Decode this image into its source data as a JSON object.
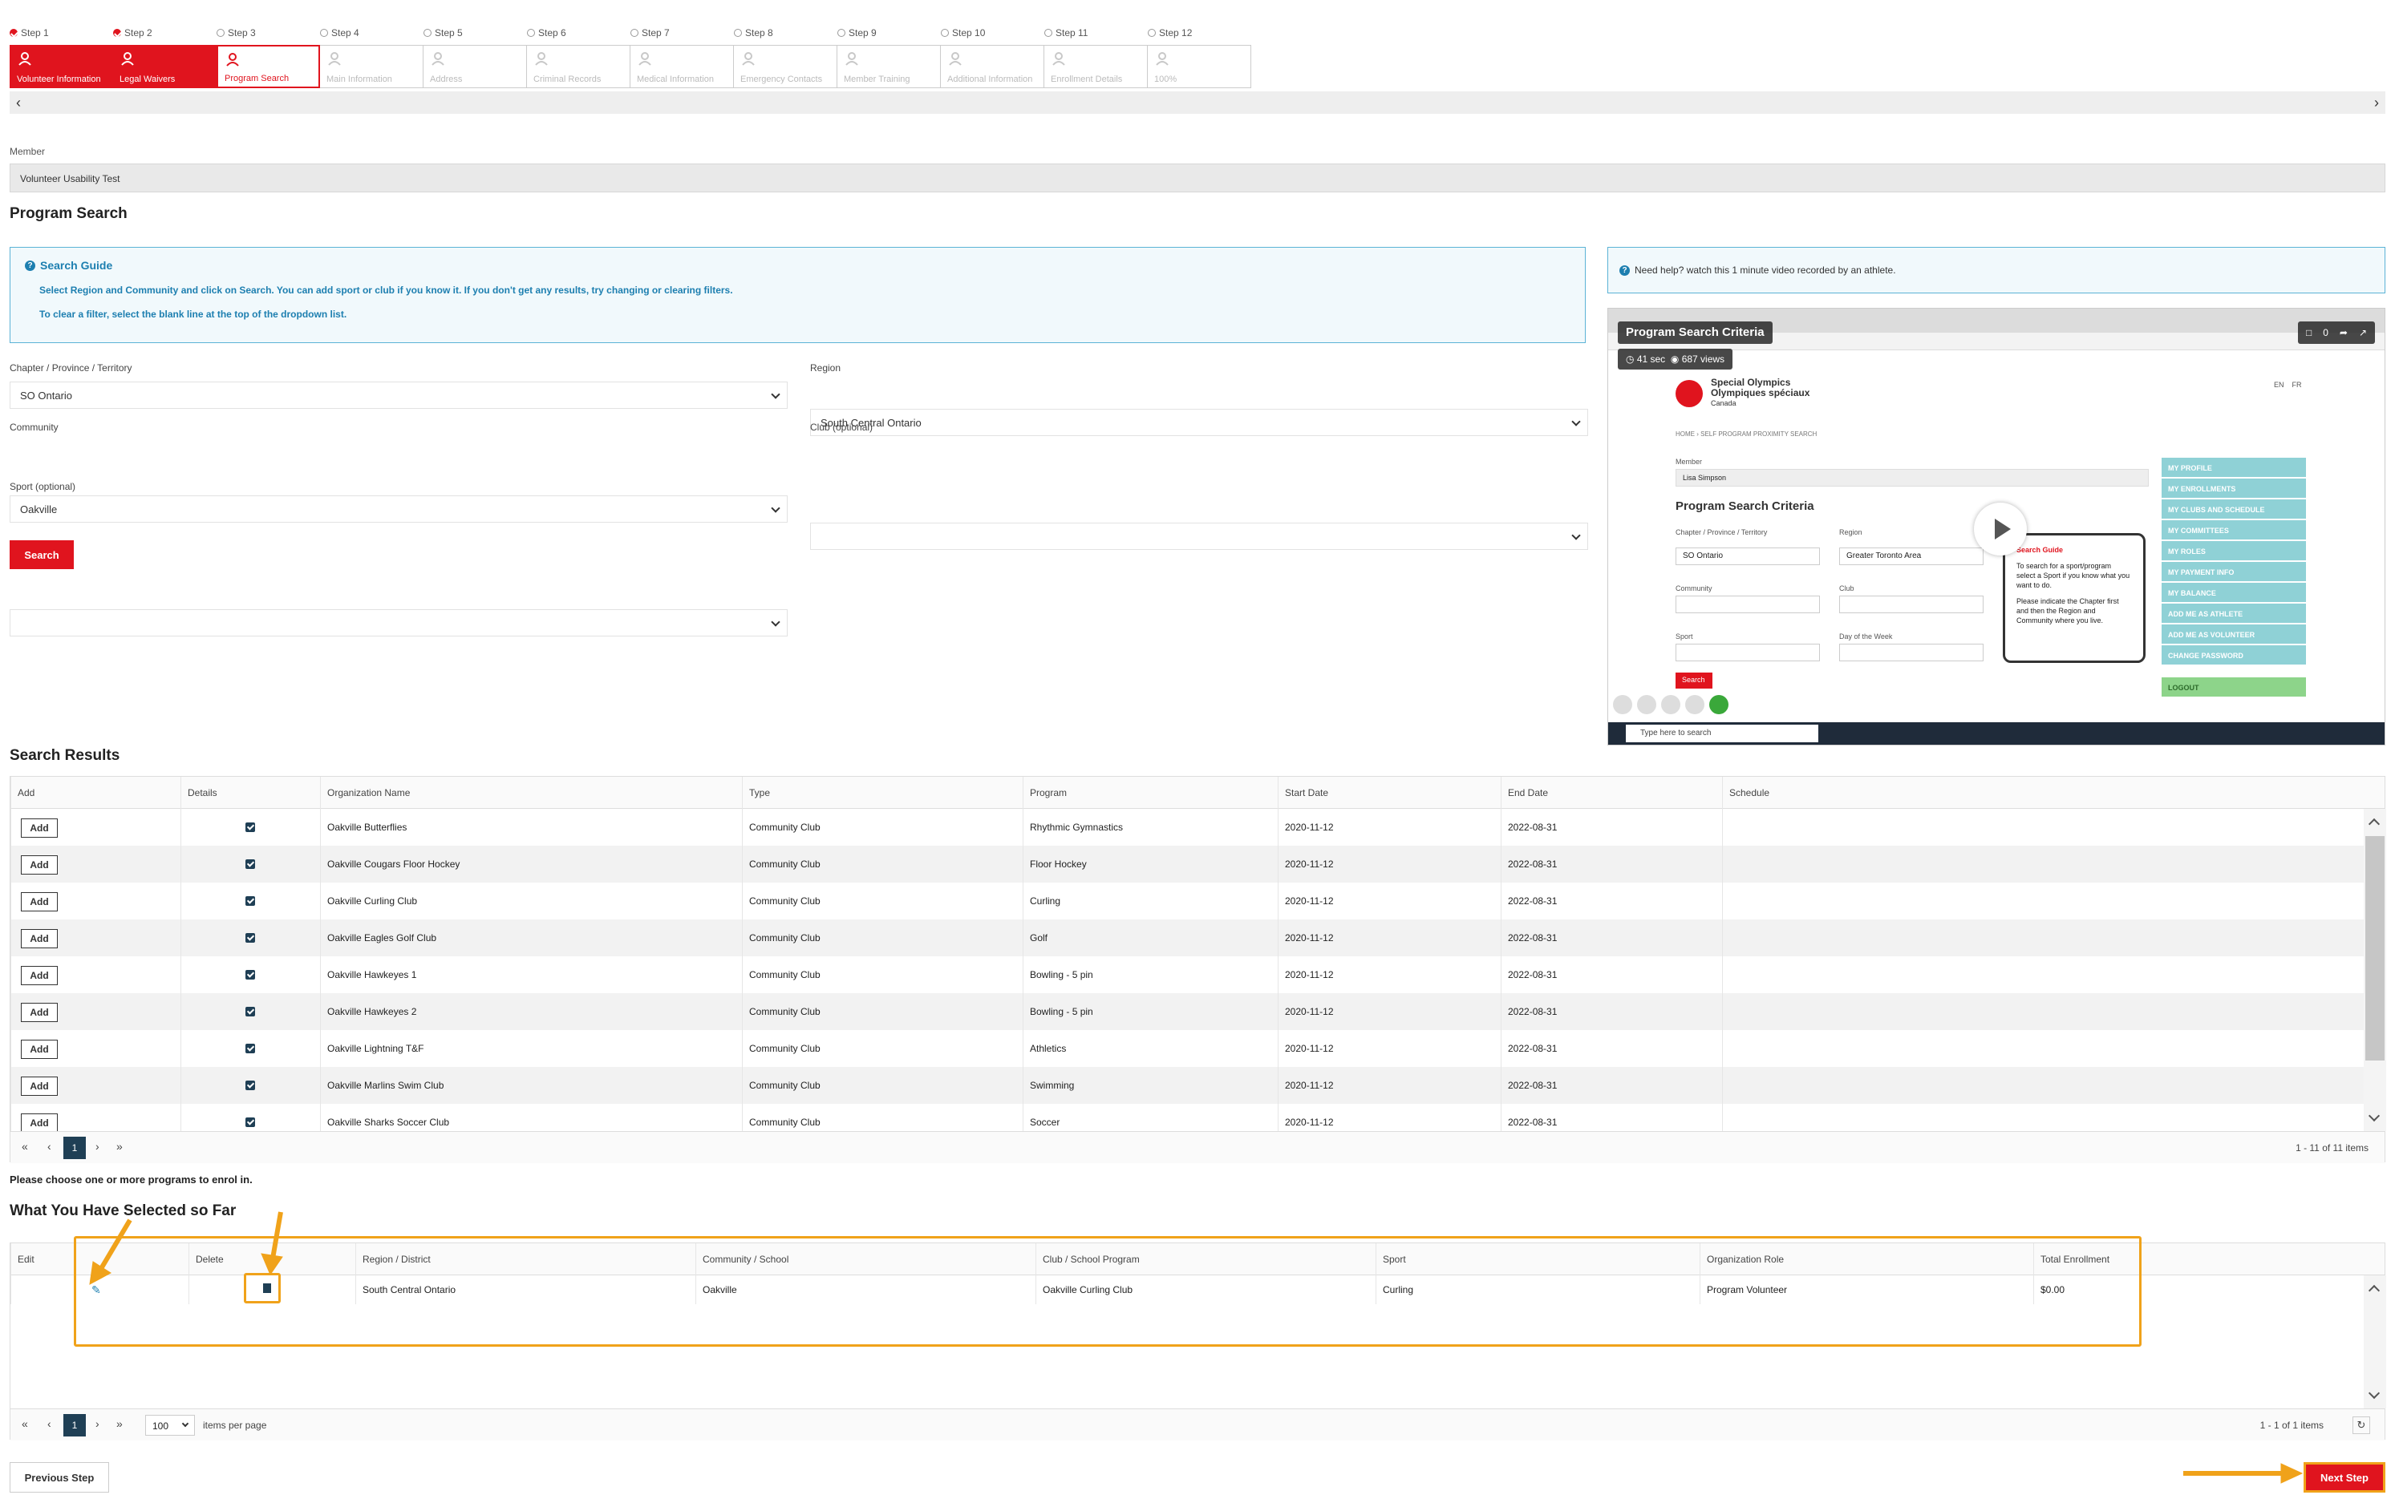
{
  "wizard": {
    "steps": [
      {
        "label": "Step 1",
        "name": "Volunteer Information",
        "state": "done"
      },
      {
        "label": "Step 2",
        "name": "Legal Waivers",
        "state": "done"
      },
      {
        "label": "Step 3",
        "name": "Program Search",
        "state": "active"
      },
      {
        "label": "Step 4",
        "name": "Main Information",
        "state": "pending"
      },
      {
        "label": "Step 5",
        "name": "Address",
        "state": "pending"
      },
      {
        "label": "Step 6",
        "name": "Criminal Records",
        "state": "pending"
      },
      {
        "label": "Step 7",
        "name": "Medical Information",
        "state": "pending"
      },
      {
        "label": "Step 8",
        "name": "Emergency Contacts",
        "state": "pending"
      },
      {
        "label": "Step 9",
        "name": "Member Training",
        "state": "pending"
      },
      {
        "label": "Step 10",
        "name": "Additional Information",
        "state": "pending"
      },
      {
        "label": "Step 11",
        "name": "Enrollment Details",
        "state": "pending"
      },
      {
        "label": "Step 12",
        "name": "100%",
        "state": "pending"
      }
    ]
  },
  "member": {
    "label": "Member",
    "value": "Volunteer Usability Test"
  },
  "page_title": "Program Search",
  "guide": {
    "title": "Search Guide",
    "line1": "Select Region and Community and click on Search. You can add sport or club if you know it. If you don't get any results, try changing or clearing filters.",
    "line2": "To clear a filter, select the blank line at the top of the dropdown list."
  },
  "help": {
    "text": "Need help? watch this 1 minute video recorded by an athlete."
  },
  "form": {
    "chapter": {
      "label": "Chapter / Province / Territory",
      "value": "SO Ontario"
    },
    "region": {
      "label": "Region",
      "value": "South Central Ontario"
    },
    "community": {
      "label": "Community",
      "value": "Oakville"
    },
    "club": {
      "label": "Club (optional)",
      "value": ""
    },
    "sport": {
      "label": "Sport (optional)",
      "value": ""
    },
    "search_label": "Search"
  },
  "video": {
    "title": "Program Search Criteria",
    "duration": "41 sec",
    "views": "687 views",
    "comments": "0",
    "org_line1": "Special Olympics",
    "org_line2": "Olympiques spéciaux",
    "org_line3": "Canada",
    "lang_en": "EN",
    "lang_fr": "FR",
    "crumb": "HOME › SELF PROGRAM PROXIMITY SEARCH",
    "member_label": "Member",
    "member_value": "Lisa Simpson",
    "criteria_title": "Program Search Criteria",
    "chapter_label": "Chapter / Province / Territory",
    "chapter_value": "SO Ontario",
    "region_label": "Region",
    "region_value": "Greater Toronto Area",
    "community_label": "Community",
    "club_label": "Club",
    "sport_label": "Sport",
    "dow_label": "Day of the Week",
    "search_label": "Search",
    "guide_title": "Search Guide",
    "guide_text1": "To search for a sport/program select a Sport if you know what you want to do.",
    "guide_text2": "Please indicate the Chapter first and then the Region and Community where you live.",
    "menu": [
      "MY PROFILE",
      "MY ENROLLMENTS",
      "MY CLUBS AND SCHEDULE",
      "MY COMMITTEES",
      "MY ROLES",
      "MY PAYMENT INFO",
      "MY BALANCE",
      "ADD ME AS ATHLETE",
      "ADD ME AS VOLUNTEER",
      "CHANGE PASSWORD"
    ],
    "logout": "LOGOUT",
    "taskbar_search": "Type here to search"
  },
  "results": {
    "title": "Search Results",
    "columns": [
      "Add",
      "Details",
      "Organization Name",
      "Type",
      "Program",
      "Start Date",
      "End Date",
      "Schedule"
    ],
    "add_label": "Add",
    "rows": [
      {
        "org": "Oakville Butterflies",
        "type": "Community Club",
        "program": "Rhythmic Gymnastics",
        "start": "2020-11-12",
        "end": "2022-08-31"
      },
      {
        "org": "Oakville Cougars Floor Hockey",
        "type": "Community Club",
        "program": "Floor Hockey",
        "start": "2020-11-12",
        "end": "2022-08-31"
      },
      {
        "org": "Oakville Curling Club",
        "type": "Community Club",
        "program": "Curling",
        "start": "2020-11-12",
        "end": "2022-08-31"
      },
      {
        "org": "Oakville Eagles Golf Club",
        "type": "Community Club",
        "program": "Golf",
        "start": "2020-11-12",
        "end": "2022-08-31"
      },
      {
        "org": "Oakville Hawkeyes 1",
        "type": "Community Club",
        "program": "Bowling - 5 pin",
        "start": "2020-11-12",
        "end": "2022-08-31"
      },
      {
        "org": "Oakville Hawkeyes 2",
        "type": "Community Club",
        "program": "Bowling - 5 pin",
        "start": "2020-11-12",
        "end": "2022-08-31"
      },
      {
        "org": "Oakville Lightning T&F",
        "type": "Community Club",
        "program": "Athletics",
        "start": "2020-11-12",
        "end": "2022-08-31"
      },
      {
        "org": "Oakville Marlins Swim Club",
        "type": "Community Club",
        "program": "Swimming",
        "start": "2020-11-12",
        "end": "2022-08-31"
      },
      {
        "org": "Oakville Sharks Soccer Club",
        "type": "Community Club",
        "program": "Soccer",
        "start": "2020-11-12",
        "end": "2022-08-31"
      }
    ],
    "page": "1",
    "info": "1 - 11 of 11 items"
  },
  "choose_note": "Please choose one or more programs to enrol in.",
  "selected": {
    "title": "What You Have Selected so Far",
    "columns": [
      "Edit",
      "Delete",
      "Region / District",
      "Community / School",
      "Club / School Program",
      "Sport",
      "Organization Role",
      "Total Enrollment"
    ],
    "rows": [
      {
        "region": "South Central Ontario",
        "community": "Oakville",
        "club": "Oakville Curling Club",
        "sport": "Curling",
        "role": "Program Volunteer",
        "total": "$0.00"
      }
    ],
    "page": "1",
    "page_size": "100",
    "page_size_label": "items per page",
    "info": "1 - 1 of 1 items"
  },
  "nav": {
    "prev": "Previous Step",
    "next": "Next Step"
  },
  "colors": {
    "brand": "#e0141e",
    "annotation": "#f0a21a",
    "info": "#1d7fb0"
  }
}
